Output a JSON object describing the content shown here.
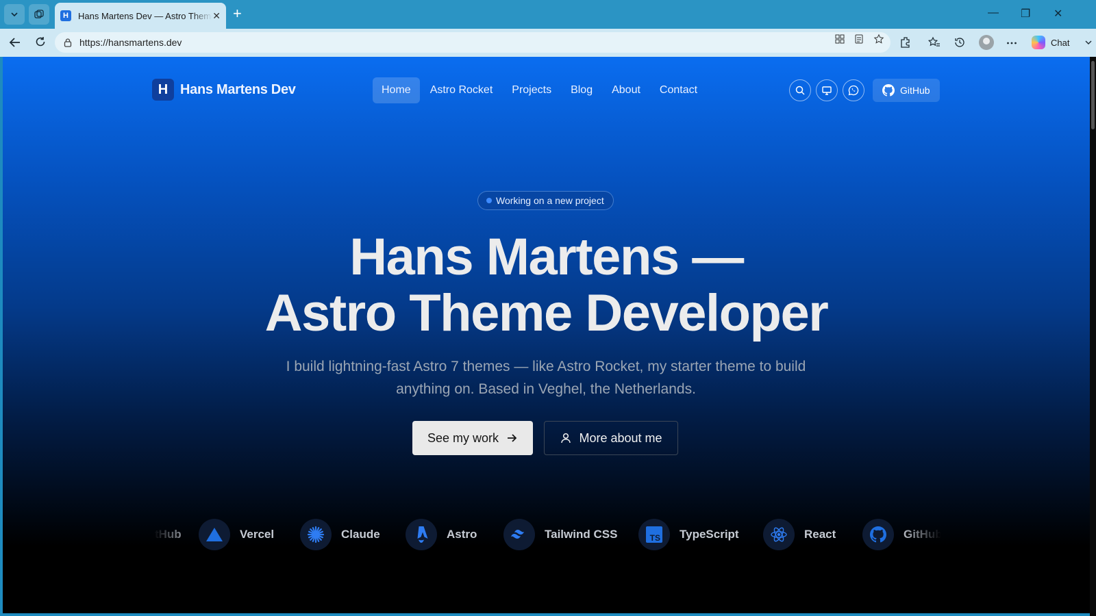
{
  "browser": {
    "tab_title": "Hans Martens Dev — Astro Theme Developer",
    "tab_favicon_letter": "H",
    "url": "https://hansmartens.dev",
    "chat_label": "Chat"
  },
  "site": {
    "brand_letter": "H",
    "brand_name": "Hans Martens Dev",
    "nav": [
      {
        "label": "Home",
        "active": true
      },
      {
        "label": "Astro Rocket",
        "active": false
      },
      {
        "label": "Projects",
        "active": false
      },
      {
        "label": "Blog",
        "active": false
      },
      {
        "label": "About",
        "active": false
      },
      {
        "label": "Contact",
        "active": false
      }
    ],
    "github_label": "GitHub"
  },
  "hero": {
    "badge": "Working on a new project",
    "title_line1": "Hans Martens —",
    "title_line2": "Astro Theme Developer",
    "subtitle": "I build lightning-fast Astro 7 themes — like Astro Rocket, my starter theme to build anything on. Based in Veghel, the Netherlands.",
    "primary_cta": "See my work",
    "secondary_cta": "More about me"
  },
  "tech_logos": [
    {
      "name": "GitHub",
      "icon": "github-icon",
      "color": "#1f6fe0"
    },
    {
      "name": "Vercel",
      "icon": "vercel-icon",
      "color": "#1f6fe0"
    },
    {
      "name": "Claude",
      "icon": "claude-icon",
      "color": "#2e7cf2"
    },
    {
      "name": "Astro",
      "icon": "astro-icon",
      "color": "#2e7cf2"
    },
    {
      "name": "Tailwind CSS",
      "icon": "tailwind-icon",
      "color": "#2e7cf2"
    },
    {
      "name": "TypeScript",
      "icon": "typescript-icon",
      "color": "#1f6fe0"
    },
    {
      "name": "React",
      "icon": "react-icon",
      "color": "#2e7cf2"
    },
    {
      "name": "GitHub",
      "icon": "github-icon",
      "color": "#1f6fe0"
    }
  ],
  "colors": {
    "accent": "#0a6df0",
    "page_bottom": "#000000"
  }
}
